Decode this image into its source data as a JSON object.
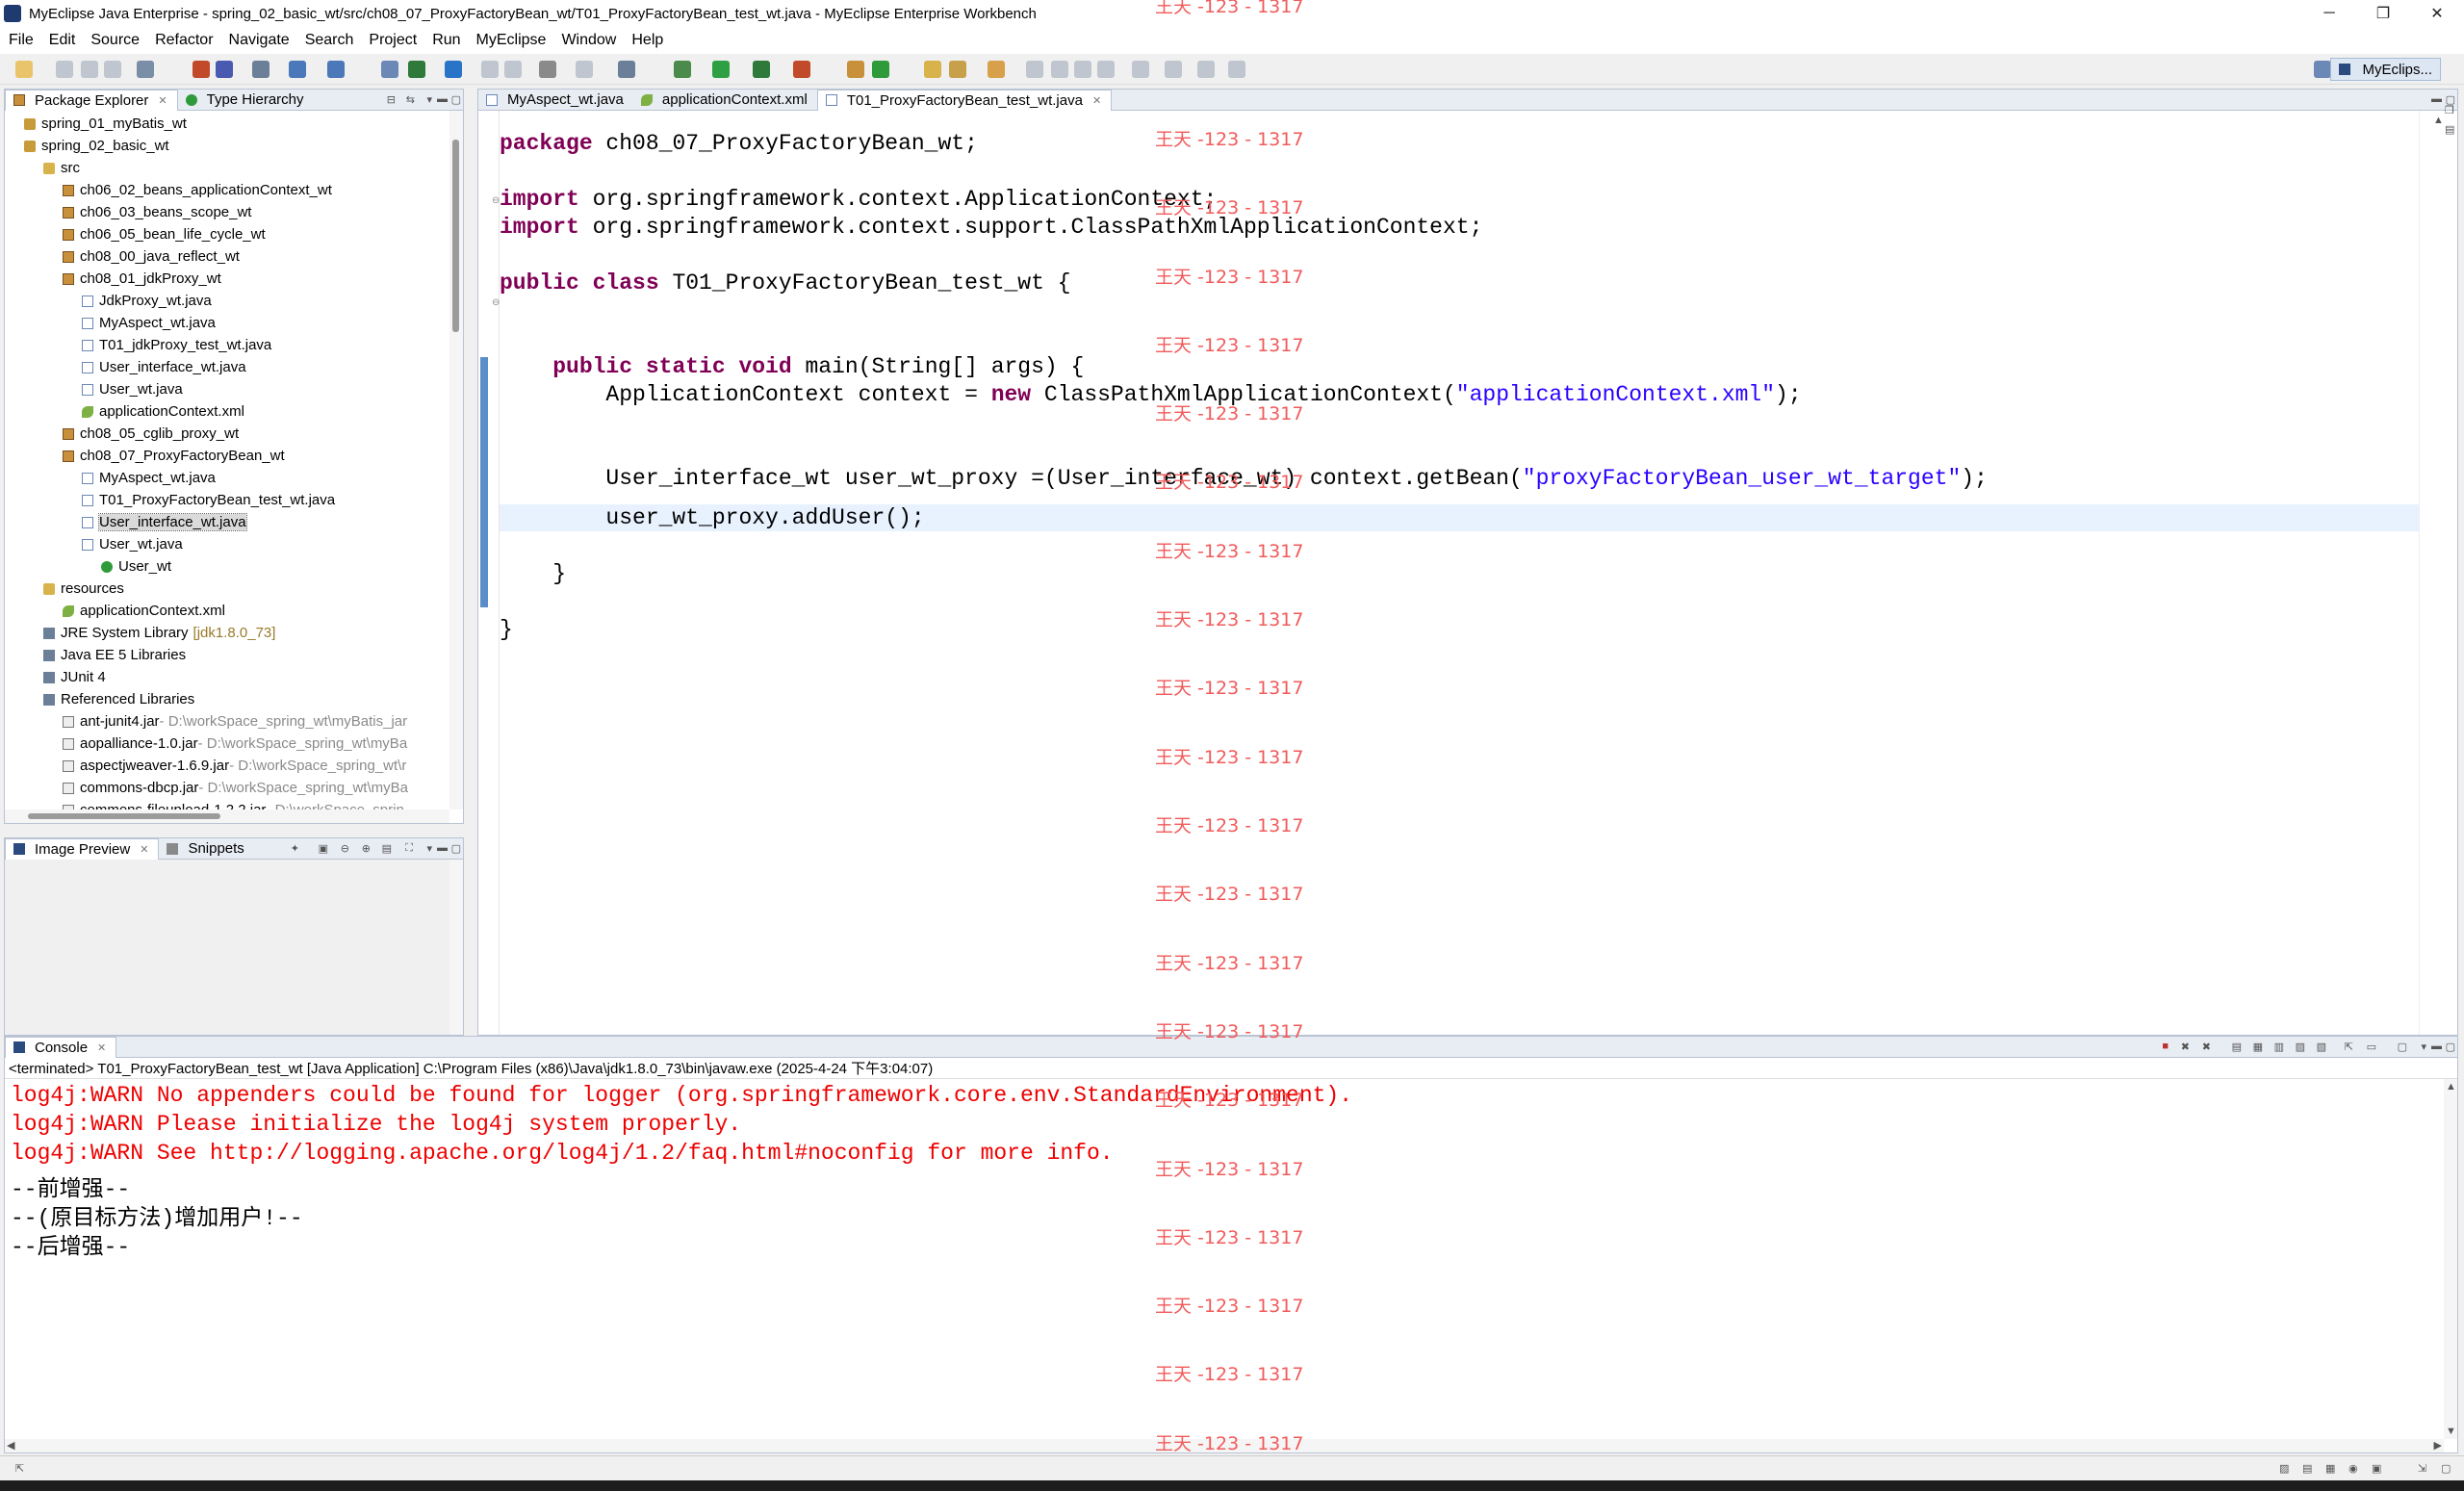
{
  "window": {
    "title": "MyEclipse Java Enterprise - spring_02_basic_wt/src/ch08_07_ProxyFactoryBean_wt/T01_ProxyFactoryBean_test_wt.java - MyEclipse Enterprise Workbench",
    "min": "─",
    "max": "❐",
    "close": "✕"
  },
  "menu": [
    "File",
    "Edit",
    "Source",
    "Refactor",
    "Navigate",
    "Search",
    "Project",
    "Run",
    "MyEclipse",
    "Window",
    "Help"
  ],
  "perspective": {
    "label": "MyEclips..."
  },
  "package_explorer": {
    "tabs": [
      "Package Explorer",
      "Type Hierarchy"
    ],
    "items": [
      {
        "label": "spring_01_myBatis_wt",
        "icon": "project"
      },
      {
        "label": "spring_02_basic_wt",
        "icon": "project"
      },
      {
        "label": "src",
        "icon": "source-folder"
      },
      {
        "label": "ch06_02_beans_applicationContext_wt",
        "icon": "package"
      },
      {
        "label": "ch06_03_beans_scope_wt",
        "icon": "package"
      },
      {
        "label": "ch06_05_bean_life_cycle_wt",
        "icon": "package"
      },
      {
        "label": "ch08_00_java_reflect_wt",
        "icon": "package"
      },
      {
        "label": "ch08_01_jdkProxy_wt",
        "icon": "package"
      },
      {
        "label": "JdkProxy_wt.java",
        "icon": "java-file"
      },
      {
        "label": "MyAspect_wt.java",
        "icon": "java-file"
      },
      {
        "label": "T01_jdkProxy_test_wt.java",
        "icon": "java-file"
      },
      {
        "label": "User_interface_wt.java",
        "icon": "java-file"
      },
      {
        "label": "User_wt.java",
        "icon": "java-file"
      },
      {
        "label": "applicationContext.xml",
        "icon": "xml-file"
      },
      {
        "label": "ch08_05_cglib_proxy_wt",
        "icon": "package"
      },
      {
        "label": "ch08_07_ProxyFactoryBean_wt",
        "icon": "package"
      },
      {
        "label": "MyAspect_wt.java",
        "icon": "java-file"
      },
      {
        "label": "T01_ProxyFactoryBean_test_wt.java",
        "icon": "java-file"
      },
      {
        "label": "User_interface_wt.java",
        "icon": "java-file"
      },
      {
        "label": "User_wt.java",
        "icon": "java-file"
      },
      {
        "label": "User_wt",
        "icon": "class"
      },
      {
        "label": "resources",
        "icon": "source-folder"
      },
      {
        "label": "applicationContext.xml",
        "icon": "xml-file"
      },
      {
        "label": "JRE System Library",
        "icon": "library",
        "suffix": "[jdk1.8.0_73]"
      },
      {
        "label": "Java EE 5 Libraries",
        "icon": "library"
      },
      {
        "label": "JUnit 4",
        "icon": "library"
      },
      {
        "label": "Referenced Libraries",
        "icon": "library"
      },
      {
        "label": "ant-junit4.jar",
        "icon": "jar",
        "suffix": " - D:\\workSpace_spring_wt\\myBatis_jar"
      },
      {
        "label": "aopalliance-1.0.jar",
        "icon": "jar",
        "suffix": " - D:\\workSpace_spring_wt\\myBa"
      },
      {
        "label": "aspectjweaver-1.6.9.jar",
        "icon": "jar",
        "suffix": " - D:\\workSpace_spring_wt\\r"
      },
      {
        "label": "commons-dbcp.jar",
        "icon": "jar",
        "suffix": " - D:\\workSpace_spring_wt\\myBa"
      },
      {
        "label": "commons-fileupload-1.2.2.jar",
        "icon": "jar",
        "suffix": " - D:\\workSpace_sprin"
      }
    ]
  },
  "image_preview": {
    "tabs": [
      "Image Preview",
      "Snippets"
    ]
  },
  "editor": {
    "tabs": [
      "MyAspect_wt.java",
      "applicationContext.xml",
      "T01_ProxyFactoryBean_test_wt.java"
    ],
    "code": {
      "l1_kw": "package",
      "l1_rest": " ch08_07_ProxyFactoryBean_wt;",
      "l3_kw": "import",
      "l3_rest": " org.springframework.context.ApplicationContext;",
      "l4_kw": "import",
      "l4_rest": " org.springframework.context.support.ClassPathXmlApplicationContext;",
      "l6_kw": "public class",
      "l6_rest": " T01_ProxyFactoryBean_test_wt {",
      "l9_indent": "    ",
      "l9_kw": "public static void",
      "l9_rest": " main(String[] args) {",
      "l10_pre": "        ApplicationContext context = ",
      "l10_kw": "new",
      "l10_mid": " ClassPathXmlApplicationContext(",
      "l10_str": "\"applicationContext.xml\"",
      "l10_end": ");",
      "l13_pre": "        User_interface_wt user_wt_proxy =(User_interface_wt) context.getBean(",
      "l13_str": "\"proxyFactoryBean_user_wt_target\"",
      "l13_end": ");",
      "l15": "        user_wt_proxy.addUser();",
      "l17": "    }",
      "l19": "}"
    }
  },
  "console": {
    "tab": "Console",
    "description": "<terminated> T01_ProxyFactoryBean_test_wt [Java Application] C:\\Program Files (x86)\\Java\\jdk1.8.0_73\\bin\\javaw.exe (2025-4-24 下午3:04:07)",
    "lines": [
      {
        "text": "log4j:WARN No appenders could be found for logger (org.springframework.core.env.StandardEnvironment).",
        "level": "warn"
      },
      {
        "text": "log4j:WARN Please initialize the log4j system properly.",
        "level": "warn"
      },
      {
        "text": "log4j:WARN See http://logging.apache.org/log4j/1.2/faq.html#noconfig for more info.",
        "level": "warn"
      },
      {
        "text": "--前增强--",
        "level": "out"
      },
      {
        "text": "--(原目标方法)增加用户!--",
        "level": "out"
      },
      {
        "text": "--后增强--",
        "level": "out"
      }
    ]
  },
  "watermark": {
    "text": "王天 -123 - 1317",
    "color": "#f25a5a"
  },
  "colors": {
    "keyword": "#7f0055",
    "string": "#2a00ff",
    "warn": "#e00000",
    "current_line": "#e8f2fe"
  }
}
